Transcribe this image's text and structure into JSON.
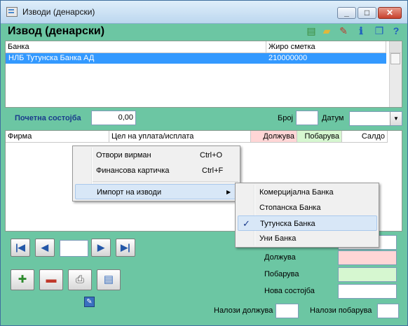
{
  "window": {
    "title": "Изводи (денарски)",
    "minimize_glyph": "_",
    "maximize_glyph": "□",
    "close_glyph": "✕"
  },
  "heading": "Извод (денарски)",
  "toolbar": [
    {
      "icon": "document-icon",
      "glyph": "▤"
    },
    {
      "icon": "folder-icon",
      "glyph": "▰"
    },
    {
      "icon": "pencil-icon",
      "glyph": "✎"
    },
    {
      "icon": "info-icon",
      "glyph": "ℹ"
    },
    {
      "icon": "window-icon",
      "glyph": "❐"
    },
    {
      "icon": "help-icon",
      "glyph": "?"
    }
  ],
  "banks_table": {
    "columns": [
      "Банка",
      "Жиро сметка"
    ],
    "rows": [
      {
        "bank": "НЛБ Тутунска Банка АД",
        "account": "210000000"
      }
    ]
  },
  "balance": {
    "label": "Почетна состојба",
    "value": "0,00"
  },
  "number_label": "Број",
  "date_label": "Датум",
  "items_table": {
    "columns": [
      "Фирма",
      "Цел на уплата/исплата",
      "Должува",
      "Побарува",
      "Салдо"
    ]
  },
  "context_menu": {
    "items": [
      "Отвори вирман",
      "Финансова картичка",
      "Импорт на изводи"
    ],
    "shortcuts": [
      "Ctrl+O",
      "Ctrl+F"
    ]
  },
  "submenu": {
    "items": [
      "Комерцијална Банка",
      "Стопанска Банка",
      "Тутунска Банка",
      "Уни Банка"
    ],
    "checked_index": 2
  },
  "summary": {
    "debit_label": "Должува",
    "credit_label": "Побарува",
    "new_balance_label": "Нова состојба",
    "orders_debit_label": "Налози должува",
    "orders_credit_label": "Налози побарува"
  },
  "colors": {
    "debit": "#ffd6d6",
    "credit": "#d6f7d0",
    "background": "#6cc6a3",
    "selection": "#3399ff"
  }
}
